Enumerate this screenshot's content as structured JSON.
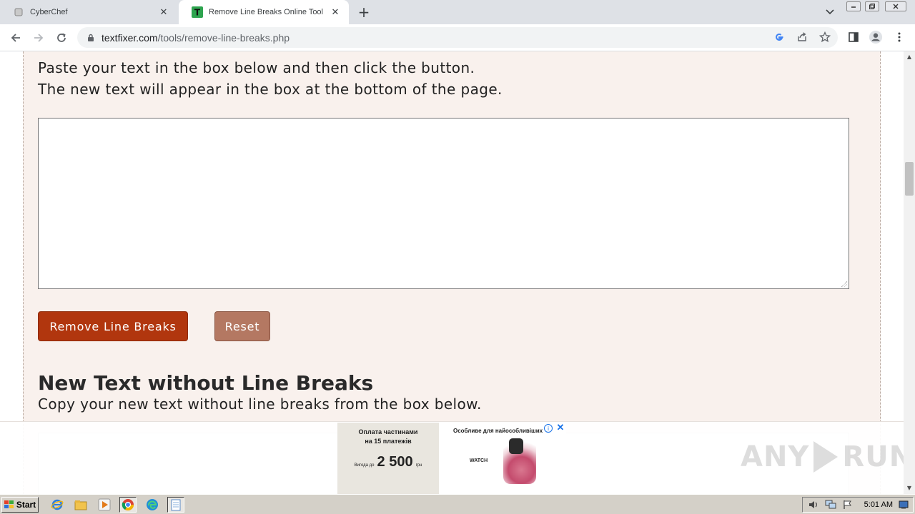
{
  "browser": {
    "tabs": [
      {
        "label": "CyberChef",
        "active": false
      },
      {
        "label": "Remove Line Breaks Online Tool",
        "active": true
      }
    ],
    "new_tab_symbol": "+",
    "url_domain": "textfixer.com",
    "url_path": "/tools/remove-line-breaks.php"
  },
  "page": {
    "instructions_line1": "Paste your text in the box below and then click the button.",
    "instructions_line2": "The new text will appear in the box at the bottom of the page.",
    "input_value": "",
    "remove_button_label": "Remove Line Breaks",
    "reset_button_label": "Reset",
    "section_heading": "New Text without Line Breaks",
    "section_subtext": "Copy your new text without line breaks from the box below.",
    "output_value": ""
  },
  "ad": {
    "left_line1": "Оплата частинами",
    "left_line2": "на 15 платежів",
    "price_prefix": "Вигода до",
    "price": "2 500",
    "price_unit": "грн",
    "right_title": "Особливе для найособливіших",
    "watch_label": "WATCH",
    "info_symbol": "i",
    "close_symbol": "✕"
  },
  "watermark": {
    "left": "ANY",
    "right": "RUN"
  },
  "taskbar": {
    "start_label": "Start",
    "clock": "5:01 AM"
  },
  "colors": {
    "panel_bg": "#f9f1ed",
    "primary_button": "#b1360e",
    "reset_button": "#b47862",
    "favicon_green": "#2ea44f"
  },
  "icons": {
    "tab_close": "close-icon",
    "back": "arrow-left-icon",
    "forward": "arrow-right-icon",
    "reload": "reload-icon",
    "lock": "lock-icon",
    "google": "google-icon",
    "share": "share-icon",
    "bookmark": "star-icon",
    "sidepanel": "side-panel-icon",
    "profile": "profile-icon",
    "menu": "kebab-menu-icon"
  }
}
